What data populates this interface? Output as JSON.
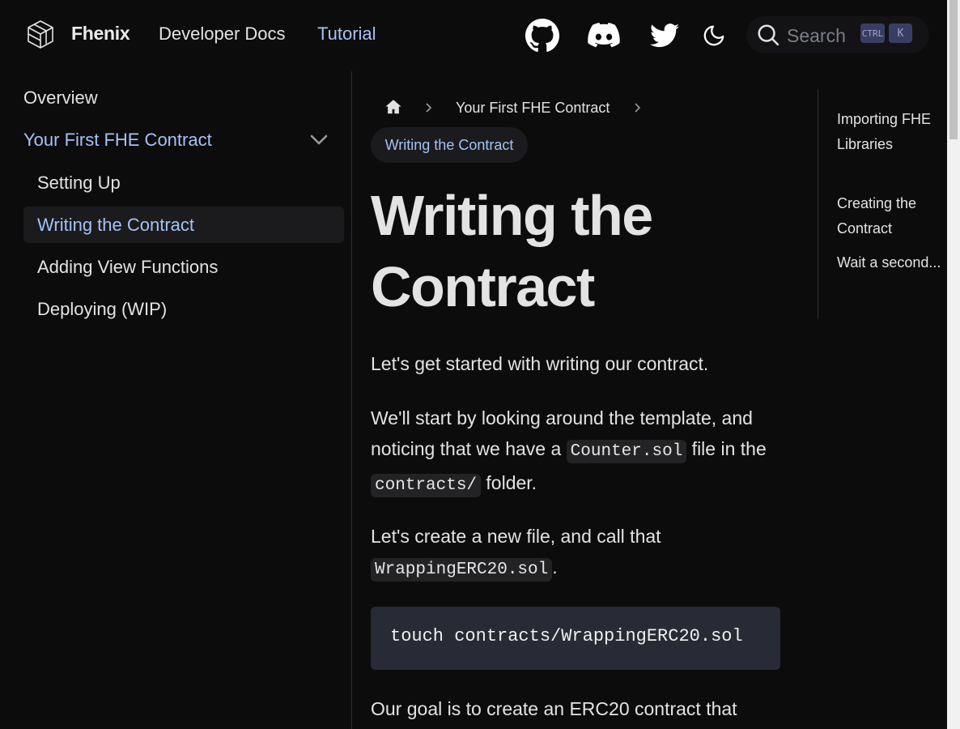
{
  "navbar": {
    "brand": "Fhenix",
    "links": [
      {
        "label": "Developer Docs",
        "active": false
      },
      {
        "label": "Tutorial",
        "active": true
      }
    ],
    "icons": [
      "github-icon",
      "discord-icon",
      "twitter-icon",
      "moon-icon"
    ],
    "search": {
      "placeholder": "Search",
      "shortcut_1": "CTRL",
      "shortcut_2": "K"
    }
  },
  "sidebar": {
    "items": [
      {
        "label": "Overview"
      },
      {
        "label": "Your First FHE Contract",
        "expanded": true
      },
      {
        "label": "Setting Up"
      },
      {
        "label": "Writing the Contract",
        "active": true
      },
      {
        "label": "Adding View Functions"
      },
      {
        "label": "Deploying (WIP)"
      }
    ]
  },
  "breadcrumb": {
    "parent": "Your First FHE Contract",
    "current": "Writing the Contract"
  },
  "main": {
    "title": "Writing the Contract",
    "p1": "Let's get started with writing our contract.",
    "p2_a": "We'll start by looking around the template, and noticing that we have a ",
    "p2_code1": "Counter.sol",
    "p2_b": " file in the ",
    "p2_code2": "contracts/",
    "p2_c": " folder.",
    "p3_a": "Let's create a new file, and call that ",
    "p3_code": "WrappingERC20.sol",
    "p3_b": ".",
    "code_block": "touch contracts/WrappingERC20.sol",
    "p4": "Our goal is to create an ERC20 contract that"
  },
  "toc": {
    "items": [
      {
        "label": "Importing FHE Libraries"
      },
      {
        "label": "Creating the Contract"
      },
      {
        "label": "Wait a second..."
      }
    ]
  },
  "colors": {
    "background": "#0c0c0d",
    "accent": "#a4c3f5",
    "code_block_bg": "#282a36"
  }
}
